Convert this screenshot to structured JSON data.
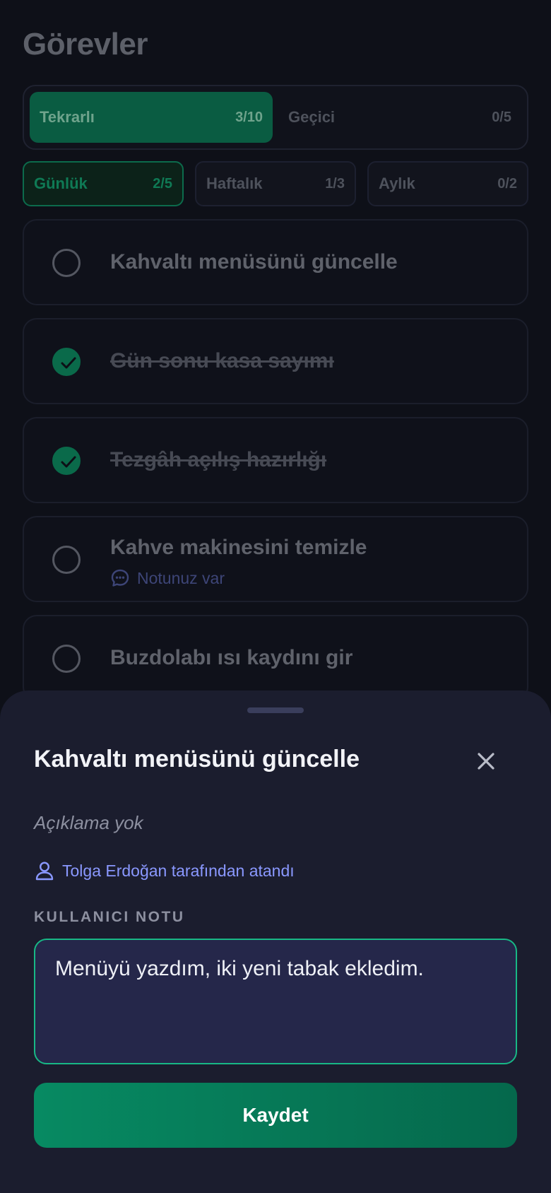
{
  "page": {
    "title": "Görevler"
  },
  "segments": [
    {
      "label": "Tekrarlı",
      "count": "3/10",
      "active": true
    },
    {
      "label": "Geçici",
      "count": "0/5",
      "active": false
    }
  ],
  "periods": [
    {
      "label": "Günlük",
      "count": "2/5",
      "active": true
    },
    {
      "label": "Haftalık",
      "count": "1/3",
      "active": false
    },
    {
      "label": "Aylık",
      "count": "0/2",
      "active": false
    }
  ],
  "tasks": [
    {
      "label": "Kahvaltı menüsünü güncelle",
      "done": false
    },
    {
      "label": "Gün sonu kasa sayımı",
      "done": true
    },
    {
      "label": "Tezgâh açılış hazırlığı",
      "done": true
    },
    {
      "label": "Kahve makinesini temizle",
      "done": false,
      "note": "Notunuz var"
    },
    {
      "label": "Buzdolabı ısı kaydını gir",
      "done": false
    }
  ],
  "sheet": {
    "title": "Kahvaltı menüsünü güncelle",
    "description": "Açıklama yok",
    "assigned_by": "Tolga Erdoğan tarafından atandı",
    "note_label": "KULLANICI NOTU",
    "note_value": "Menüyü yazdım, iki yeni tabak ekledim.",
    "save_label": "Kaydet"
  },
  "colors": {
    "accent": "#0a6a4a",
    "focus_border": "#18b886",
    "link": "#8a98ff",
    "sheet_bg": "#1b1d2e"
  },
  "icons": [
    "check-icon",
    "chat-bubble-icon",
    "close-icon",
    "user-icon"
  ]
}
